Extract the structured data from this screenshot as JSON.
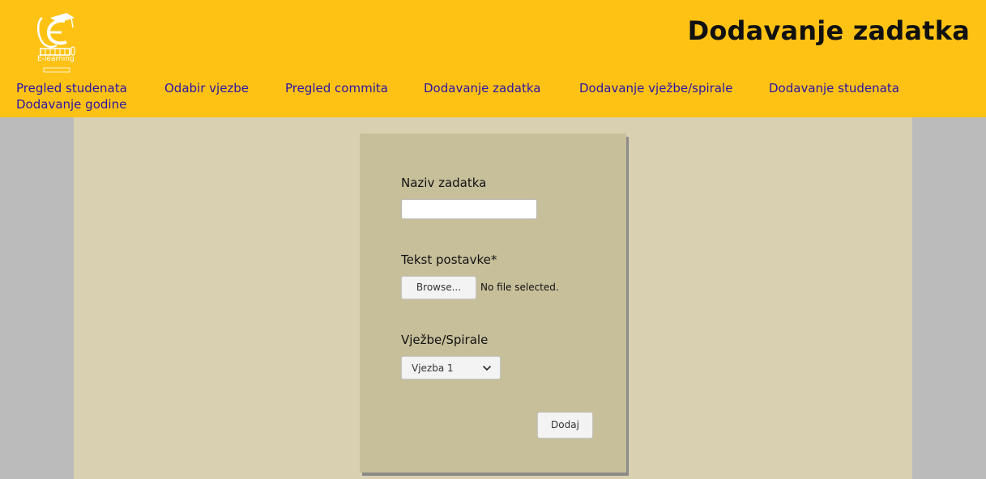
{
  "header": {
    "title": "Dodavanje zadatka",
    "logo_text": "E-learning",
    "logo_icon": "graduation-cap-e-logo"
  },
  "nav": {
    "items": [
      {
        "label": "Pregled studenata"
      },
      {
        "label": "Odabir vjezbe"
      },
      {
        "label": "Pregled commita"
      },
      {
        "label": "Dodavanje zadatka"
      },
      {
        "label": "Dodavanje vježbe/spirale"
      },
      {
        "label": "Dodavanje studenata"
      },
      {
        "label": "Dodavanje godine"
      }
    ]
  },
  "form": {
    "task_name_label": "Naziv zadatka",
    "task_name_value": "",
    "assignment_text_label": "Tekst postavke*",
    "browse_label": "Browse...",
    "file_status": "No file selected.",
    "exercise_label": "Vježbe/Spirale",
    "exercise_selected": "Vjezba 1",
    "submit_label": "Dodaj"
  },
  "colors": {
    "header_bg": "#fec214",
    "nav_link": "#2a14a8",
    "content_bg": "#d9d0b1",
    "form_bg": "#c7bf9a",
    "page_bg": "#bcbbbb"
  }
}
